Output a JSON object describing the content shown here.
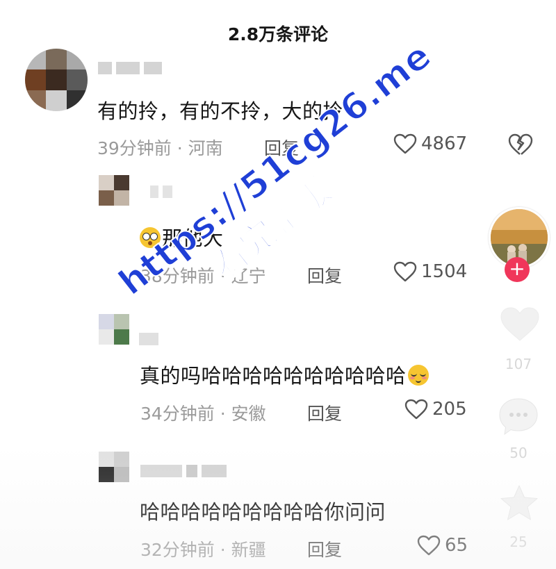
{
  "header": {
    "title": "2.8万条评论"
  },
  "comments": [
    {
      "text": "有的拎，有的不拎，大的拎",
      "time_location": "39分钟前 · 河南",
      "reply_label": "回复",
      "likes": "4867"
    },
    {
      "text": "那他大",
      "time_location": "38分钟前 · 辽宁",
      "reply_label": "回复",
      "likes": "1504"
    },
    {
      "text": "真的吗哈哈哈哈哈哈哈哈哈哈",
      "time_location": "34分钟前 · 安徽",
      "reply_label": "回复",
      "likes": "205"
    },
    {
      "text": "哈哈哈哈哈哈哈哈哈你问问",
      "time_location": "32分钟前 · 新疆",
      "reply_label": "回复",
      "likes": "65"
    }
  ],
  "side_rail": {
    "like_count": "107",
    "comment_count": "50",
    "favorite_count": "25",
    "follow_icon": "plus-icon"
  },
  "watermark": {
    "url": "https://51cg26.me",
    "text": "看完整版"
  },
  "colors": {
    "meta_gray": "#9a9a9a",
    "follow_red": "#f0365a",
    "watermark_blue": "#1f3fd6"
  }
}
